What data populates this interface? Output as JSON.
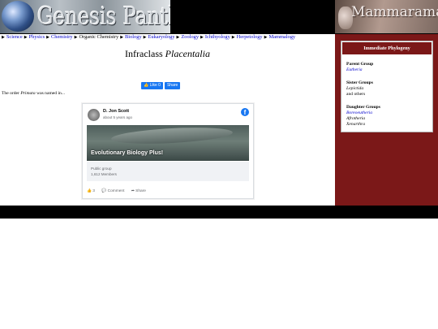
{
  "header": {
    "logo_text": "Genesis Pantheis",
    "banner_text": "Mammarama"
  },
  "breadcrumb": [
    {
      "label": "Science",
      "link": true
    },
    {
      "label": "Physics",
      "link": true
    },
    {
      "label": "Chemistry",
      "link": true
    },
    {
      "label": "Organic Chemistry",
      "link": false
    },
    {
      "label": "Biology",
      "link": true
    },
    {
      "label": "Eukaryology",
      "link": true
    },
    {
      "label": "Zoology",
      "link": true
    },
    {
      "label": "Ichthyology",
      "link": true
    },
    {
      "label": "Herpetology",
      "link": true
    },
    {
      "label": "Mammalogy",
      "link": true
    }
  ],
  "main": {
    "title_prefix": "Infraclass",
    "title_taxon": "Placentalia",
    "like_label": "👍 Like 0",
    "share_label": "Share",
    "order_prefix": "The order",
    "order_taxon": "Primata",
    "order_suffix": "was named in..."
  },
  "embed": {
    "poster": "D. Jon Scott",
    "time": "about 5 years ago",
    "group_name": "Evolutionary Biology Plus!",
    "group_type": "Public group",
    "members": "1,612 Members",
    "likes": "👍 3",
    "comment": "💬 Comment",
    "share": "➦ Share"
  },
  "sidebar": {
    "header": "Immediate Phylogeny",
    "parent_heading": "Parent Group",
    "parent": "Eutheria",
    "sister_heading": "Sister Groups",
    "sister_1": "Lepictida",
    "sister_2": "and others",
    "daughter_heading": "Daughter Groups",
    "daughter_1": "Boreoeutheria",
    "daughter_2": "Afrotheria",
    "daughter_3": "Xenarthra"
  },
  "colors": {
    "sidebar_bg": "#7b1818",
    "link": "#0000cc",
    "facebook_blue": "#1877f2"
  }
}
